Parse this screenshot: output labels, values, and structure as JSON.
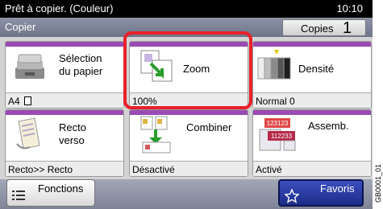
{
  "status_bar": {
    "message": "Prêt à copier. (Couleur)",
    "time": "10:10"
  },
  "title_bar": {
    "title": "Copier",
    "copies_label": "Copies",
    "copies_count": "1"
  },
  "tiles": [
    {
      "label": "Sélection\ndu papier",
      "value": "A4",
      "icon": "paper-tray-icon"
    },
    {
      "label": "Zoom",
      "value": "100%",
      "icon": "zoom-icon"
    },
    {
      "label": "Densité",
      "value": "Normal 0",
      "icon": "density-icon"
    },
    {
      "label": "Recto\nverso",
      "value": "Recto>> Recto",
      "icon": "duplex-icon"
    },
    {
      "label": "Combiner",
      "value": "Désactivé",
      "icon": "combine-icon"
    },
    {
      "label": "Assemb.",
      "value": "Activé",
      "icon": "collate-icon"
    }
  ],
  "collate_icon_digits": [
    "123123",
    "112233"
  ],
  "bottom_bar": {
    "fonctions_label": "Fonctions",
    "favoris_label": "Favoris"
  },
  "side_code": "GB0001_01",
  "colors": {
    "tile_accent": "#9a4bb3",
    "highlight": "#e8202a",
    "favoris": "#2a3aa8"
  }
}
